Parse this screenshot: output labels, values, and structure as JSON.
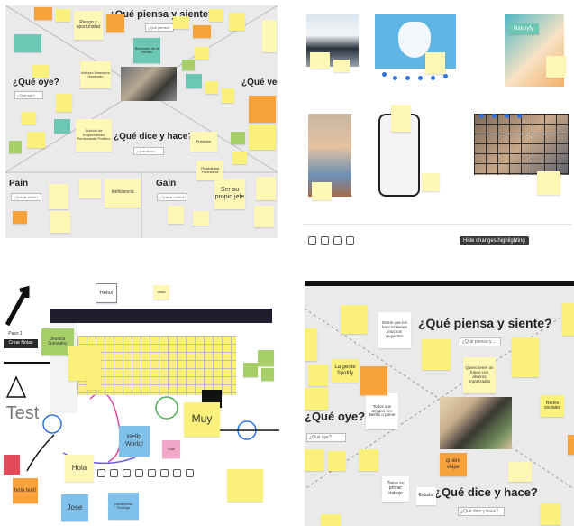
{
  "colors": {
    "board_bg": "#eaeaea",
    "sticky_yellow": "#fbf07a",
    "sticky_orange": "#f7a23b",
    "sticky_green": "#a6cf6a",
    "sticky_teal": "#6dc7b5",
    "sticky_pink": "#f2a7c8",
    "sticky_blue": "#7fc1ea",
    "selection_blue": "#2d73e6"
  },
  "p1": {
    "h_piensa": "¿Qué piensa y siente?",
    "h_oye": "¿Qué oye?",
    "h_ve": "¿Qué ve?",
    "h_dice": "¿Qué dice y hace?",
    "h_pain": "Pain",
    "h_gain": "Gain",
    "n_riesgo": "Riesgo y oportunidad",
    "n_bienestar": "Bienestar de la familia",
    "n_articulo": "Artículo financiero Haciendo",
    "n_emprendedor": "Artículo de Emprendedor Permanente Positivo",
    "n_flexibilidad": "Flexibilidad Financiera",
    "n_ser": "Ser su propio jefe",
    "n_inefic": "Ineficiencia",
    "n_publicitar": "Publicitar"
  },
  "p2": {
    "tooltip": "Hide changes highlighting",
    "brand": "Nannyfy"
  },
  "p3": {
    "n_hello": "Hello!",
    "n_hello_small": "Hello",
    "n_jessica": "Jessica Gonzalez",
    "n_paso": "Paso 1",
    "n_crear": "Crear Notas",
    "n_test": "Test",
    "n_muy": "Muy",
    "n_hello_world": "Hello World!",
    "n_hola": "Hola",
    "n_hola_test": "hola test!",
    "n_jose": "Jose",
    "n_practicando": "practicando Rodrigo",
    "n_hola_pink": "hola"
  },
  "p4": {
    "h_piensa": "¿Qué piensa y siente?",
    "h_oye": "¿Qué oye?",
    "h_dice": "¿Qué dice y hace?",
    "n_deme": "Deme que los bancos tienen muchos requisitos",
    "n_quiero": "Quiero tener un futuro con ahorros organizados",
    "n_todos": "Todos sus amigos ven Netflix o prime",
    "n_la_gente": "La gente Spotify",
    "n_quiere_viajar": "quiere viajar",
    "n_tiene": "Tiene su primer trabajo",
    "n_estudia": "Estudia",
    "n_redes": "Redes sociales",
    "f_piensa": "¿Qué piensa y ...",
    "f_dice": "¿Qué dice y hace?",
    "f_oye": "¿Qué oye?"
  }
}
